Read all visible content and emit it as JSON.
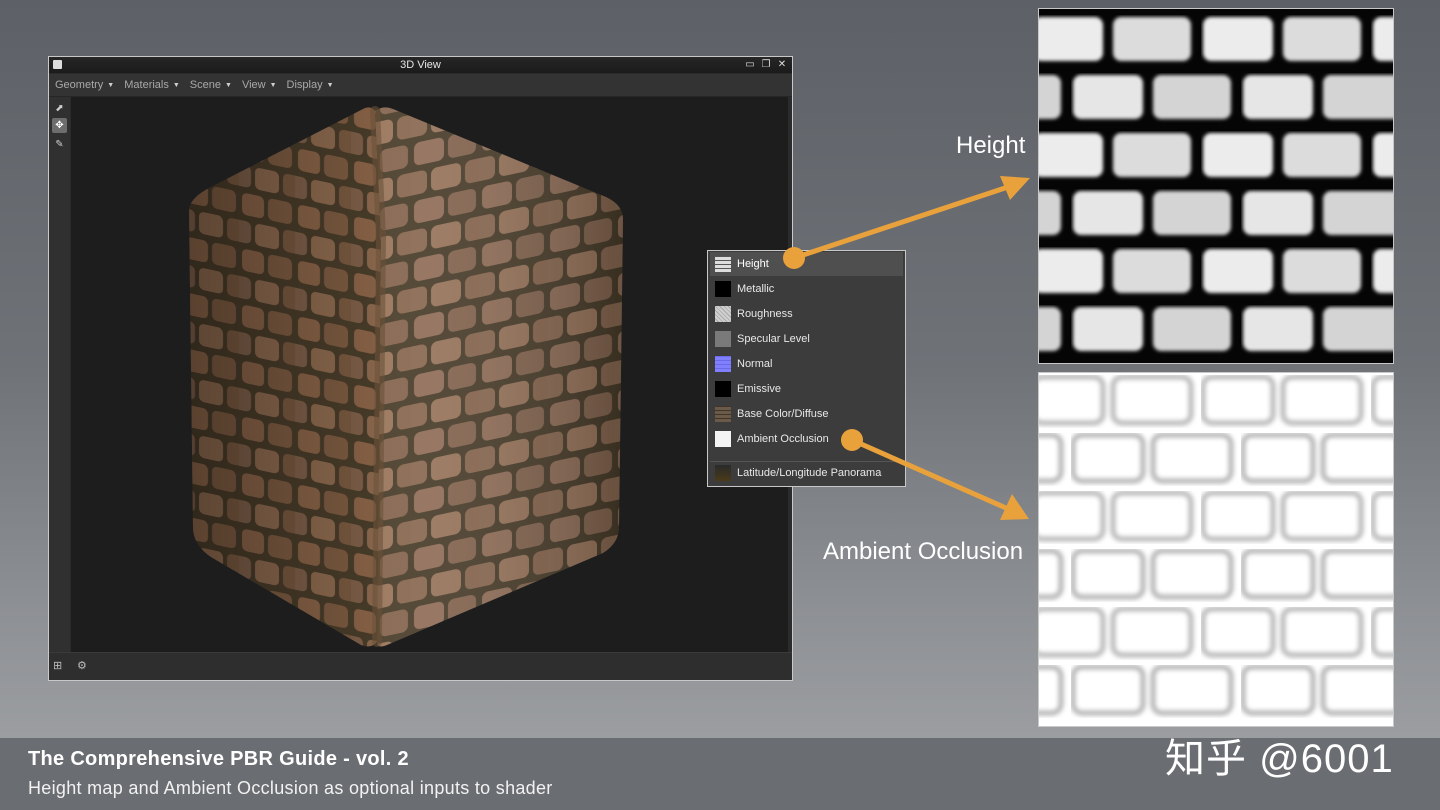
{
  "window": {
    "title": "3D View",
    "menus": [
      "Geometry",
      "Materials",
      "Scene",
      "View",
      "Display"
    ]
  },
  "dropdown": {
    "items": [
      {
        "label": "Height",
        "swatch": "height-map-swatch",
        "selected": true
      },
      {
        "label": "Metallic",
        "swatch": "black-swatch"
      },
      {
        "label": "Roughness",
        "swatch": "light-gray-noise-swatch"
      },
      {
        "label": "Specular Level",
        "swatch": "gray-swatch"
      },
      {
        "label": "Normal",
        "swatch": "blue-normal-swatch"
      },
      {
        "label": "Emissive",
        "swatch": "black-swatch"
      },
      {
        "label": "Base Color/Diffuse",
        "swatch": "brick-color-swatch"
      },
      {
        "label": "Ambient Occlusion",
        "swatch": "white-swatch"
      }
    ],
    "extra_item": {
      "label": "Latitude/Longitude Panorama",
      "swatch": "panorama-swatch"
    }
  },
  "labels": {
    "height": "Height",
    "ambient_occlusion": "Ambient Occlusion"
  },
  "caption": {
    "title": "The Comprehensive PBR Guide - vol. 2",
    "subtitle": "Height map and Ambient Occlusion as optional inputs to shader"
  },
  "watermark": "知乎 @6001",
  "colors": {
    "accent_arrow": "#e9a23b",
    "brick": "#8a6448",
    "mortar": "#4a3d2a"
  }
}
